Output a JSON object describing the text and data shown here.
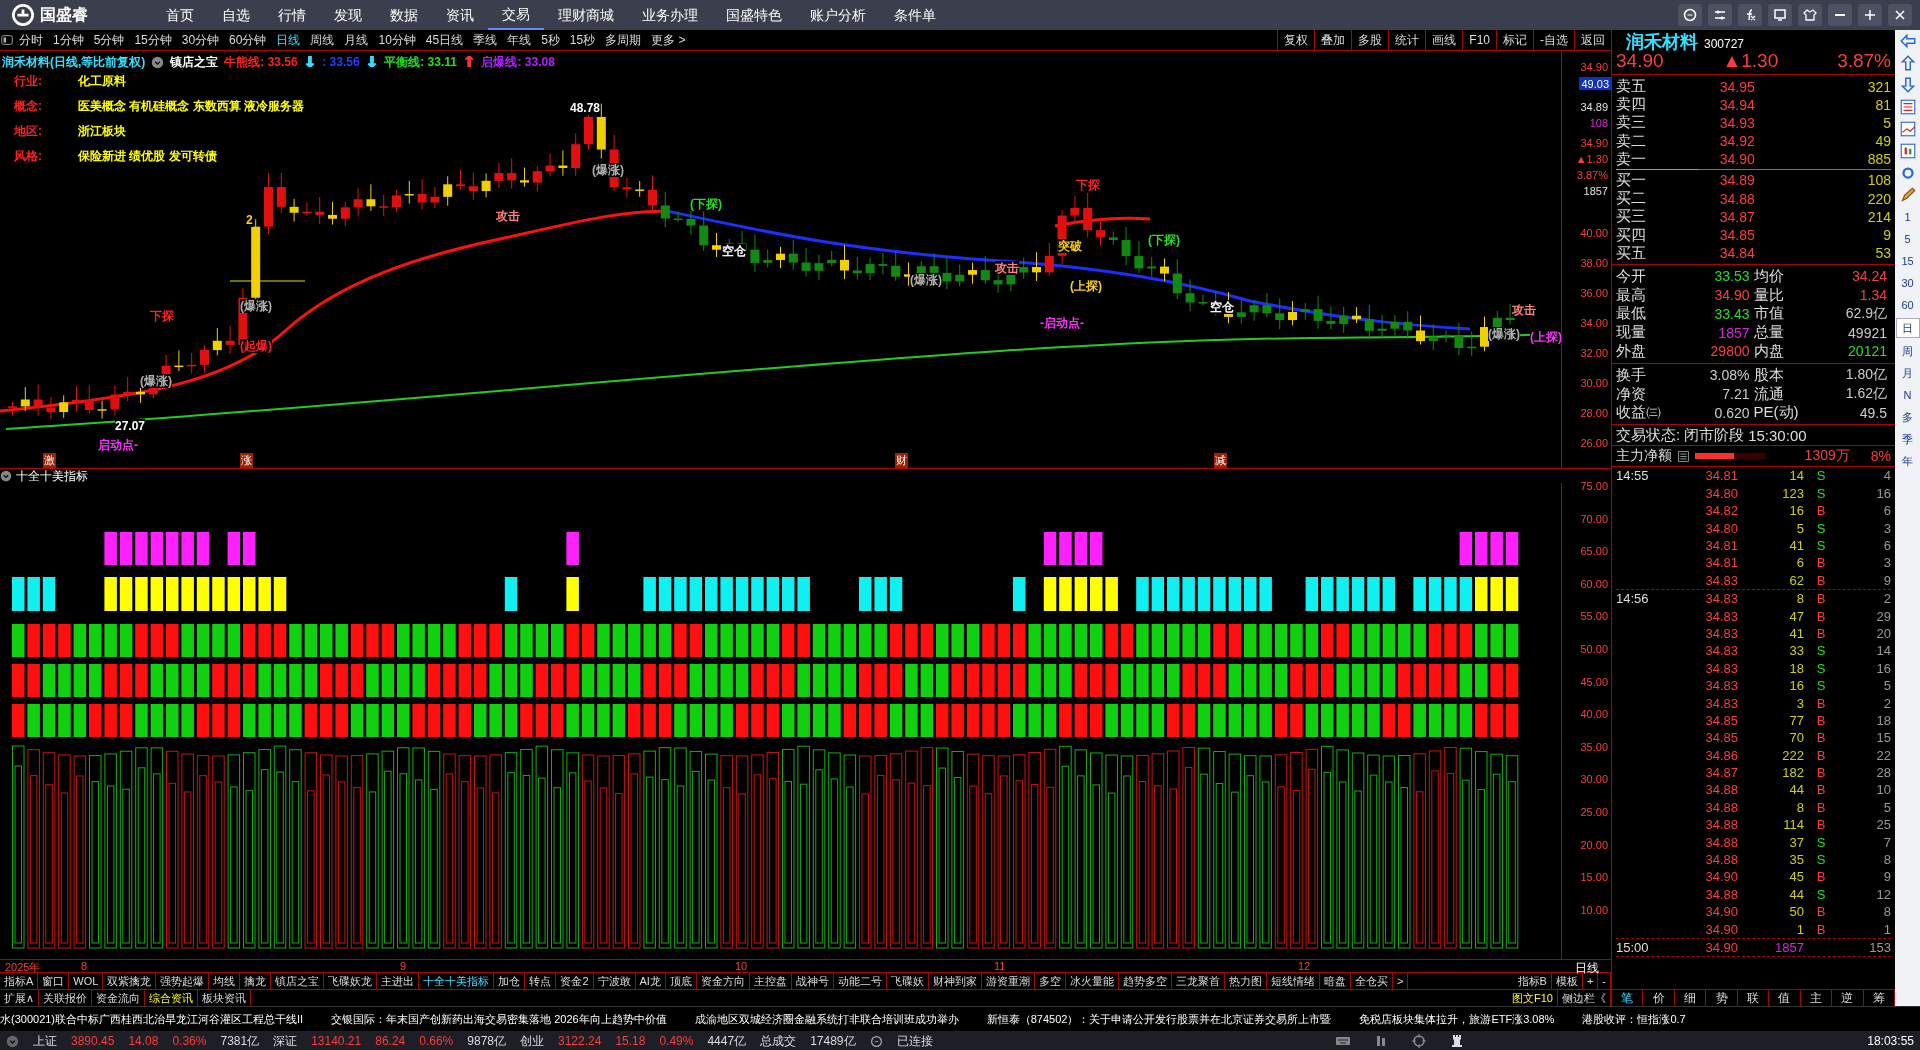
{
  "app": {
    "logo_text": "国盛睿"
  },
  "menu": [
    {
      "label": "首页",
      "selected": false
    },
    {
      "label": "自选",
      "selected": false
    },
    {
      "label": "行情",
      "selected": false
    },
    {
      "label": "发现",
      "selected": false
    },
    {
      "label": "数据",
      "selected": false
    },
    {
      "label": "资讯",
      "selected": false
    },
    {
      "label": "交易",
      "selected": true
    },
    {
      "label": "理财商城",
      "selected": false
    },
    {
      "label": "业务办理",
      "selected": false
    },
    {
      "label": "国盛特色",
      "selected": false
    },
    {
      "label": "账户分析",
      "selected": false
    },
    {
      "label": "条件单",
      "selected": false
    }
  ],
  "periods": [
    {
      "label": "分时",
      "selected": false
    },
    {
      "label": "1分钟",
      "selected": false
    },
    {
      "label": "5分钟",
      "selected": false
    },
    {
      "label": "15分钟",
      "selected": false
    },
    {
      "label": "30分钟",
      "selected": false
    },
    {
      "label": "60分钟",
      "selected": false
    },
    {
      "label": "日线",
      "selected": true
    },
    {
      "label": "周线",
      "selected": false
    },
    {
      "label": "月线",
      "selected": false
    },
    {
      "label": "10分钟",
      "selected": false
    },
    {
      "label": "45日线",
      "selected": false
    },
    {
      "label": "季线",
      "selected": false
    },
    {
      "label": "年线",
      "selected": false
    },
    {
      "label": "5秒",
      "selected": false
    },
    {
      "label": "15秒",
      "selected": false
    },
    {
      "label": "多周期",
      "selected": false
    },
    {
      "label": "更多 >",
      "selected": false
    }
  ],
  "chart_tools": [
    "复权",
    "叠加",
    "多股",
    "统计",
    "画线",
    "F10",
    "标记",
    "-自选",
    "返回"
  ],
  "chart": {
    "title": "润禾材料(日线,等比前复权)",
    "indicator_name": "镇店之宝",
    "lines": [
      {
        "label": "牛熊线: 33.56",
        "arrow": {
          "text": "↓",
          "color": "#30e0ff"
        },
        "color": "#ff2020"
      },
      {
        "label": ": 33.56",
        "arrow": {
          "text": "↓",
          "color": "#30e0ff"
        },
        "color": "#2040ff"
      },
      {
        "label": "平衡线: 33.11",
        "arrow": {
          "text": "↑",
          "color": "#ff3030"
        },
        "color": "#20e020"
      },
      {
        "label": "启爆线: 33.08",
        "color": "#b020ff"
      }
    ],
    "info": [
      {
        "label": "行业:",
        "value": "化工原料"
      },
      {
        "label": "概念:",
        "value": "医美概念 有机硅概念 东数西算 液冷服务器"
      },
      {
        "label": "地区:",
        "value": "浙江板块"
      },
      {
        "label": "风格:",
        "value": "保险新进 绩优股 发可转债"
      }
    ],
    "annotations": [
      {
        "text": "48.78",
        "color": "#ffffff"
      },
      {
        "text": "2",
        "color": "#ffd000"
      },
      {
        "text": "下探",
        "color": "#ff2020"
      },
      {
        "text": "(爆涨)",
        "color": "#b0b0b0"
      },
      {
        "text": "(起爆)",
        "color": "#ff2020"
      },
      {
        "text": "(爆涨)",
        "color": "#b0b0b0"
      },
      {
        "text": "27.07",
        "color": "#ffffff"
      },
      {
        "text": "启动点-",
        "color": "#ff30ff"
      },
      {
        "text": "(爆涨)",
        "color": "#b0b0b0"
      },
      {
        "text": "攻击",
        "color": "#ff8080"
      },
      {
        "text": "(下探)",
        "color": "#20e020"
      },
      {
        "text": "空仓",
        "color": "#ffffff"
      },
      {
        "text": "(爆涨)",
        "color": "#b0b0b0"
      },
      {
        "text": "攻击",
        "color": "#ff8080"
      },
      {
        "text": "下探",
        "color": "#ff2020"
      },
      {
        "text": "突破",
        "color": "#ffd000"
      },
      {
        "text": "(上探)",
        "color": "#ffd000"
      },
      {
        "text": "-启动点-",
        "color": "#ff30ff"
      },
      {
        "text": "(下探)",
        "color": "#20e020"
      },
      {
        "text": "空仓",
        "color": "#ffffff"
      },
      {
        "text": "攻击",
        "color": "#ff8080"
      },
      {
        "text": "(爆涨)",
        "color": "#b0b0b0"
      },
      {
        "text": "(上探)",
        "color": "#ff30ff"
      }
    ],
    "markers": [
      "激",
      "涨",
      "财",
      "减"
    ],
    "price_axis": [
      "40.00",
      "38.00",
      "36.00",
      "34.00",
      "32.00",
      "30.00",
      "28.00",
      "26.00"
    ],
    "axis_info": [
      {
        "text": "34.90",
        "kind": "up"
      },
      {
        "text": "49.03",
        "kind": "box"
      },
      {
        "text": "34.89",
        "kind": "plain"
      },
      {
        "text": "108",
        "kind": "volume"
      },
      {
        "text": "34.90",
        "kind": "up"
      },
      {
        "text": "▲1.30",
        "kind": "up"
      },
      {
        "text": "3.87%",
        "kind": "up"
      },
      {
        "text": "1857",
        "kind": "plain"
      }
    ]
  },
  "indicator": {
    "title": "十全十美指标",
    "axis": [
      "75.00",
      "70.00",
      "65.00",
      "60.00",
      "55.00",
      "50.00",
      "45.00",
      "40.00",
      "35.00",
      "30.00",
      "25.00",
      "20.00",
      "15.00",
      "10.00"
    ]
  },
  "dates": [
    "2025年",
    "8",
    "9",
    "10",
    "11",
    "12"
  ],
  "period_label": "日线",
  "indicator_tabs": [
    {
      "label": "指标A",
      "selected": false
    },
    {
      "label": "窗口",
      "selected": false
    },
    {
      "label": "WOL",
      "selected": false
    },
    {
      "label": "双紫擒龙",
      "selected": false
    },
    {
      "label": "强势起爆",
      "selected": false
    },
    {
      "label": "均线",
      "selected": false
    },
    {
      "label": "擒龙",
      "selected": false
    },
    {
      "label": "镇店之宝",
      "selected": false
    },
    {
      "label": "飞碟妖龙",
      "selected": false
    },
    {
      "label": "主进出",
      "selected": false
    },
    {
      "label": "十全十美指标",
      "selected": true
    },
    {
      "label": "加仓",
      "selected": false
    },
    {
      "label": "转点",
      "selected": false
    },
    {
      "label": "资金2",
      "selected": false
    },
    {
      "label": "宁波敢",
      "selected": false
    },
    {
      "label": "AI龙",
      "selected": false
    },
    {
      "label": "顶底",
      "selected": false
    },
    {
      "label": "资金方向",
      "selected": false
    },
    {
      "label": "主控盘",
      "selected": false
    },
    {
      "label": "战神号",
      "selected": false
    },
    {
      "label": "动能二号",
      "selected": false
    },
    {
      "label": "飞碟妖",
      "selected": false
    },
    {
      "label": "财神到家",
      "selected": false
    },
    {
      "label": "游资重潮",
      "selected": false
    },
    {
      "label": "多空",
      "selected": false
    },
    {
      "label": "冰火量能",
      "selected": false
    },
    {
      "label": "趋势多空",
      "selected": false
    },
    {
      "label": "三龙聚首",
      "selected": false
    },
    {
      "label": "热力图",
      "selected": false
    },
    {
      "label": "短线情绪",
      "selected": false
    },
    {
      "label": "暗盘",
      "selected": false
    },
    {
      "label": "全仓买",
      "selected": false
    },
    {
      "label": ">",
      "selected": false
    }
  ],
  "indicator_tabs_right": [
    "指标B",
    "模板",
    "+",
    "-"
  ],
  "info_tabs": [
    {
      "label": "扩展∧",
      "selected": false
    },
    {
      "label": "关联报价",
      "selected": false
    },
    {
      "label": "资金流向",
      "selected": false
    },
    {
      "label": "综合资讯",
      "selected": true
    },
    {
      "label": "板块资讯",
      "selected": false
    }
  ],
  "info_tabs_right": [
    "图文F10",
    "侧边栏《"
  ],
  "quote": {
    "name": "润禾材料",
    "code": "300727",
    "price": "34.90",
    "change": "▲1.30",
    "percent": "3.87%",
    "asks": [
      {
        "label": "卖五",
        "price": "34.95",
        "volume": "321"
      },
      {
        "label": "卖四",
        "price": "34.94",
        "volume": "81"
      },
      {
        "label": "卖三",
        "price": "34.93",
        "volume": "5"
      },
      {
        "label": "卖二",
        "price": "34.92",
        "volume": "49"
      },
      {
        "label": "卖一",
        "price": "34.90",
        "volume": "885"
      }
    ],
    "bids": [
      {
        "label": "买一",
        "price": "34.89",
        "volume": "108"
      },
      {
        "label": "买二",
        "price": "34.88",
        "volume": "220"
      },
      {
        "label": "买三",
        "price": "34.87",
        "volume": "214"
      },
      {
        "label": "买四",
        "price": "34.85",
        "volume": "9"
      },
      {
        "label": "买五",
        "price": "34.84",
        "volume": "53"
      }
    ],
    "stats": [
      {
        "label": "今开",
        "value": "33.53",
        "kind": "down"
      },
      {
        "label": "均价",
        "value": "34.24",
        "kind": "up"
      },
      {
        "label": "最高",
        "value": "34.90",
        "kind": "up"
      },
      {
        "label": "量比",
        "value": "1.34",
        "kind": "up"
      },
      {
        "label": "最低",
        "value": "33.43",
        "kind": "down"
      },
      {
        "label": "市值",
        "value": "62.9亿",
        "kind": "flat"
      },
      {
        "label": "现量",
        "value": "1857",
        "kind": "volume"
      },
      {
        "label": "总量",
        "value": "49921",
        "kind": "flat"
      },
      {
        "label": "外盘",
        "value": "29800",
        "kind": "up"
      },
      {
        "label": "内盘",
        "value": "20121",
        "kind": "down"
      }
    ],
    "fundamentals": [
      {
        "label": "换手",
        "value": "3.08%",
        "label2": "股本",
        "value2": "1.80亿"
      },
      {
        "label": "净资",
        "value": "7.21",
        "label2": "流通",
        "value2": "1.62亿"
      },
      {
        "label": "收益㈢",
        "value": "0.620",
        "label2": "PE(动)",
        "value2": "49.5"
      }
    ],
    "status_label": "交易状态:",
    "status_value": "闭市阶段",
    "status_time": "15:30:00",
    "main_flow": {
      "label": "主力净额",
      "level": 0.55,
      "amount": "1309万",
      "percent": "8%"
    },
    "trades": [
      {
        "time": "14:55",
        "rows": [
          {
            "price": "34.81",
            "volume": "14",
            "side": "S",
            "count": "4",
            "kind": "sell"
          },
          {
            "price": "34.80",
            "volume": "123",
            "side": "S",
            "count": "16",
            "kind": "sell"
          },
          {
            "price": "34.82",
            "volume": "16",
            "side": "B",
            "count": "6",
            "kind": "buy"
          },
          {
            "price": "34.80",
            "volume": "5",
            "side": "S",
            "count": "3",
            "kind": "sell"
          },
          {
            "price": "34.81",
            "volume": "41",
            "side": "S",
            "count": "6",
            "kind": "sell"
          },
          {
            "price": "34.81",
            "volume": "6",
            "side": "B",
            "count": "3",
            "kind": "buy"
          },
          {
            "price": "34.83",
            "volume": "62",
            "side": "B",
            "count": "9",
            "kind": "buy"
          }
        ]
      },
      {
        "time": "14:56",
        "rows": [
          {
            "price": "34.83",
            "volume": "8",
            "side": "B",
            "count": "2",
            "kind": "buy"
          },
          {
            "price": "34.83",
            "volume": "47",
            "side": "B",
            "count": "29",
            "kind": "buy"
          },
          {
            "price": "34.83",
            "volume": "41",
            "side": "B",
            "count": "20",
            "kind": "buy"
          },
          {
            "price": "34.83",
            "volume": "33",
            "side": "S",
            "count": "14",
            "kind": "sell"
          },
          {
            "price": "34.83",
            "volume": "18",
            "side": "S",
            "count": "16",
            "kind": "sell"
          },
          {
            "price": "34.83",
            "volume": "16",
            "side": "S",
            "count": "5",
            "kind": "sell"
          },
          {
            "price": "34.83",
            "volume": "3",
            "side": "B",
            "count": "2",
            "kind": "buy"
          },
          {
            "price": "34.85",
            "volume": "77",
            "side": "B",
            "count": "18",
            "kind": "buy"
          },
          {
            "price": "34.85",
            "volume": "70",
            "side": "B",
            "count": "15",
            "kind": "buy"
          },
          {
            "price": "34.86",
            "volume": "222",
            "side": "B",
            "count": "22",
            "kind": "buy"
          },
          {
            "price": "34.87",
            "volume": "182",
            "side": "B",
            "count": "28",
            "kind": "buy"
          },
          {
            "price": "34.88",
            "volume": "44",
            "side": "B",
            "count": "10",
            "kind": "buy"
          },
          {
            "price": "34.88",
            "volume": "8",
            "side": "B",
            "count": "5",
            "kind": "buy"
          },
          {
            "price": "34.88",
            "volume": "114",
            "side": "B",
            "count": "25",
            "kind": "buy"
          },
          {
            "price": "34.88",
            "volume": "37",
            "side": "S",
            "count": "7",
            "kind": "sell"
          },
          {
            "price": "34.88",
            "volume": "35",
            "side": "S",
            "count": "8",
            "kind": "sell"
          },
          {
            "price": "34.90",
            "volume": "45",
            "side": "B",
            "count": "9",
            "kind": "buy"
          },
          {
            "price": "34.88",
            "volume": "44",
            "side": "S",
            "count": "12",
            "kind": "sell"
          },
          {
            "price": "34.90",
            "volume": "50",
            "side": "B",
            "count": "8",
            "kind": "buy"
          },
          {
            "price": "34.90",
            "volume": "1",
            "side": "B",
            "count": "1",
            "kind": "buy"
          }
        ]
      },
      {
        "time": "15:00",
        "rows": [
          {
            "price": "34.90",
            "volume": "1857",
            "count": "153",
            "kind": "total"
          }
        ]
      }
    ],
    "tabs": [
      {
        "label": "笔",
        "selected": true
      },
      {
        "label": "价",
        "selected": false
      },
      {
        "label": "细",
        "selected": false
      },
      {
        "label": "势",
        "selected": false
      },
      {
        "label": "联",
        "selected": false
      },
      {
        "label": "值",
        "selected": false
      },
      {
        "label": "主",
        "selected": false
      },
      {
        "label": "逆",
        "selected": false
      },
      {
        "label": "筹",
        "selected": false
      }
    ]
  },
  "side_periods": [
    {
      "label": "1",
      "selected": false
    },
    {
      "label": "5",
      "selected": false
    },
    {
      "label": "15",
      "selected": false
    },
    {
      "label": "30",
      "selected": false
    },
    {
      "label": "60",
      "selected": false
    },
    {
      "label": "日",
      "selected": true
    },
    {
      "label": "周",
      "selected": false
    },
    {
      "label": "月",
      "selected": false
    },
    {
      "label": "N",
      "selected": false
    },
    {
      "label": "多",
      "selected": false
    },
    {
      "label": "季",
      "selected": false
    },
    {
      "label": "年",
      "selected": false
    }
  ],
  "ticker": [
    "水(300021)联合中标广西桂西北治旱龙江河谷灌区工程总干线II",
    "交银国际：年末国产创新药出海交易密集落地 2026年向上趋势中价值",
    "成渝地区双城经济圈金融系统打非联合培训班成功举办",
    "新恒泰（874502）：关于申请公开发行股票并在北京证券交易所上市暨",
    "免税店板块集体拉升，旅游ETF涨3.08%",
    "港股收评：恒指涨0.7"
  ],
  "indices": [
    {
      "name": "上证",
      "value": "3890.45",
      "change": "14.08",
      "percent": "0.36%",
      "amount": "7381亿",
      "kind": "up"
    },
    {
      "name": "深证",
      "value": "13140.21",
      "change": "86.24",
      "percent": "0.66%",
      "amount": "9878亿",
      "kind": "up"
    },
    {
      "name": "创业",
      "value": "3122.24",
      "change": "15.18",
      "percent": "0.49%",
      "amount": "4447亿",
      "kind": "up"
    }
  ],
  "total_turnover": {
    "label": "总成交",
    "value": "17489亿"
  },
  "connection": "已连接",
  "clock": "18:03:55"
}
